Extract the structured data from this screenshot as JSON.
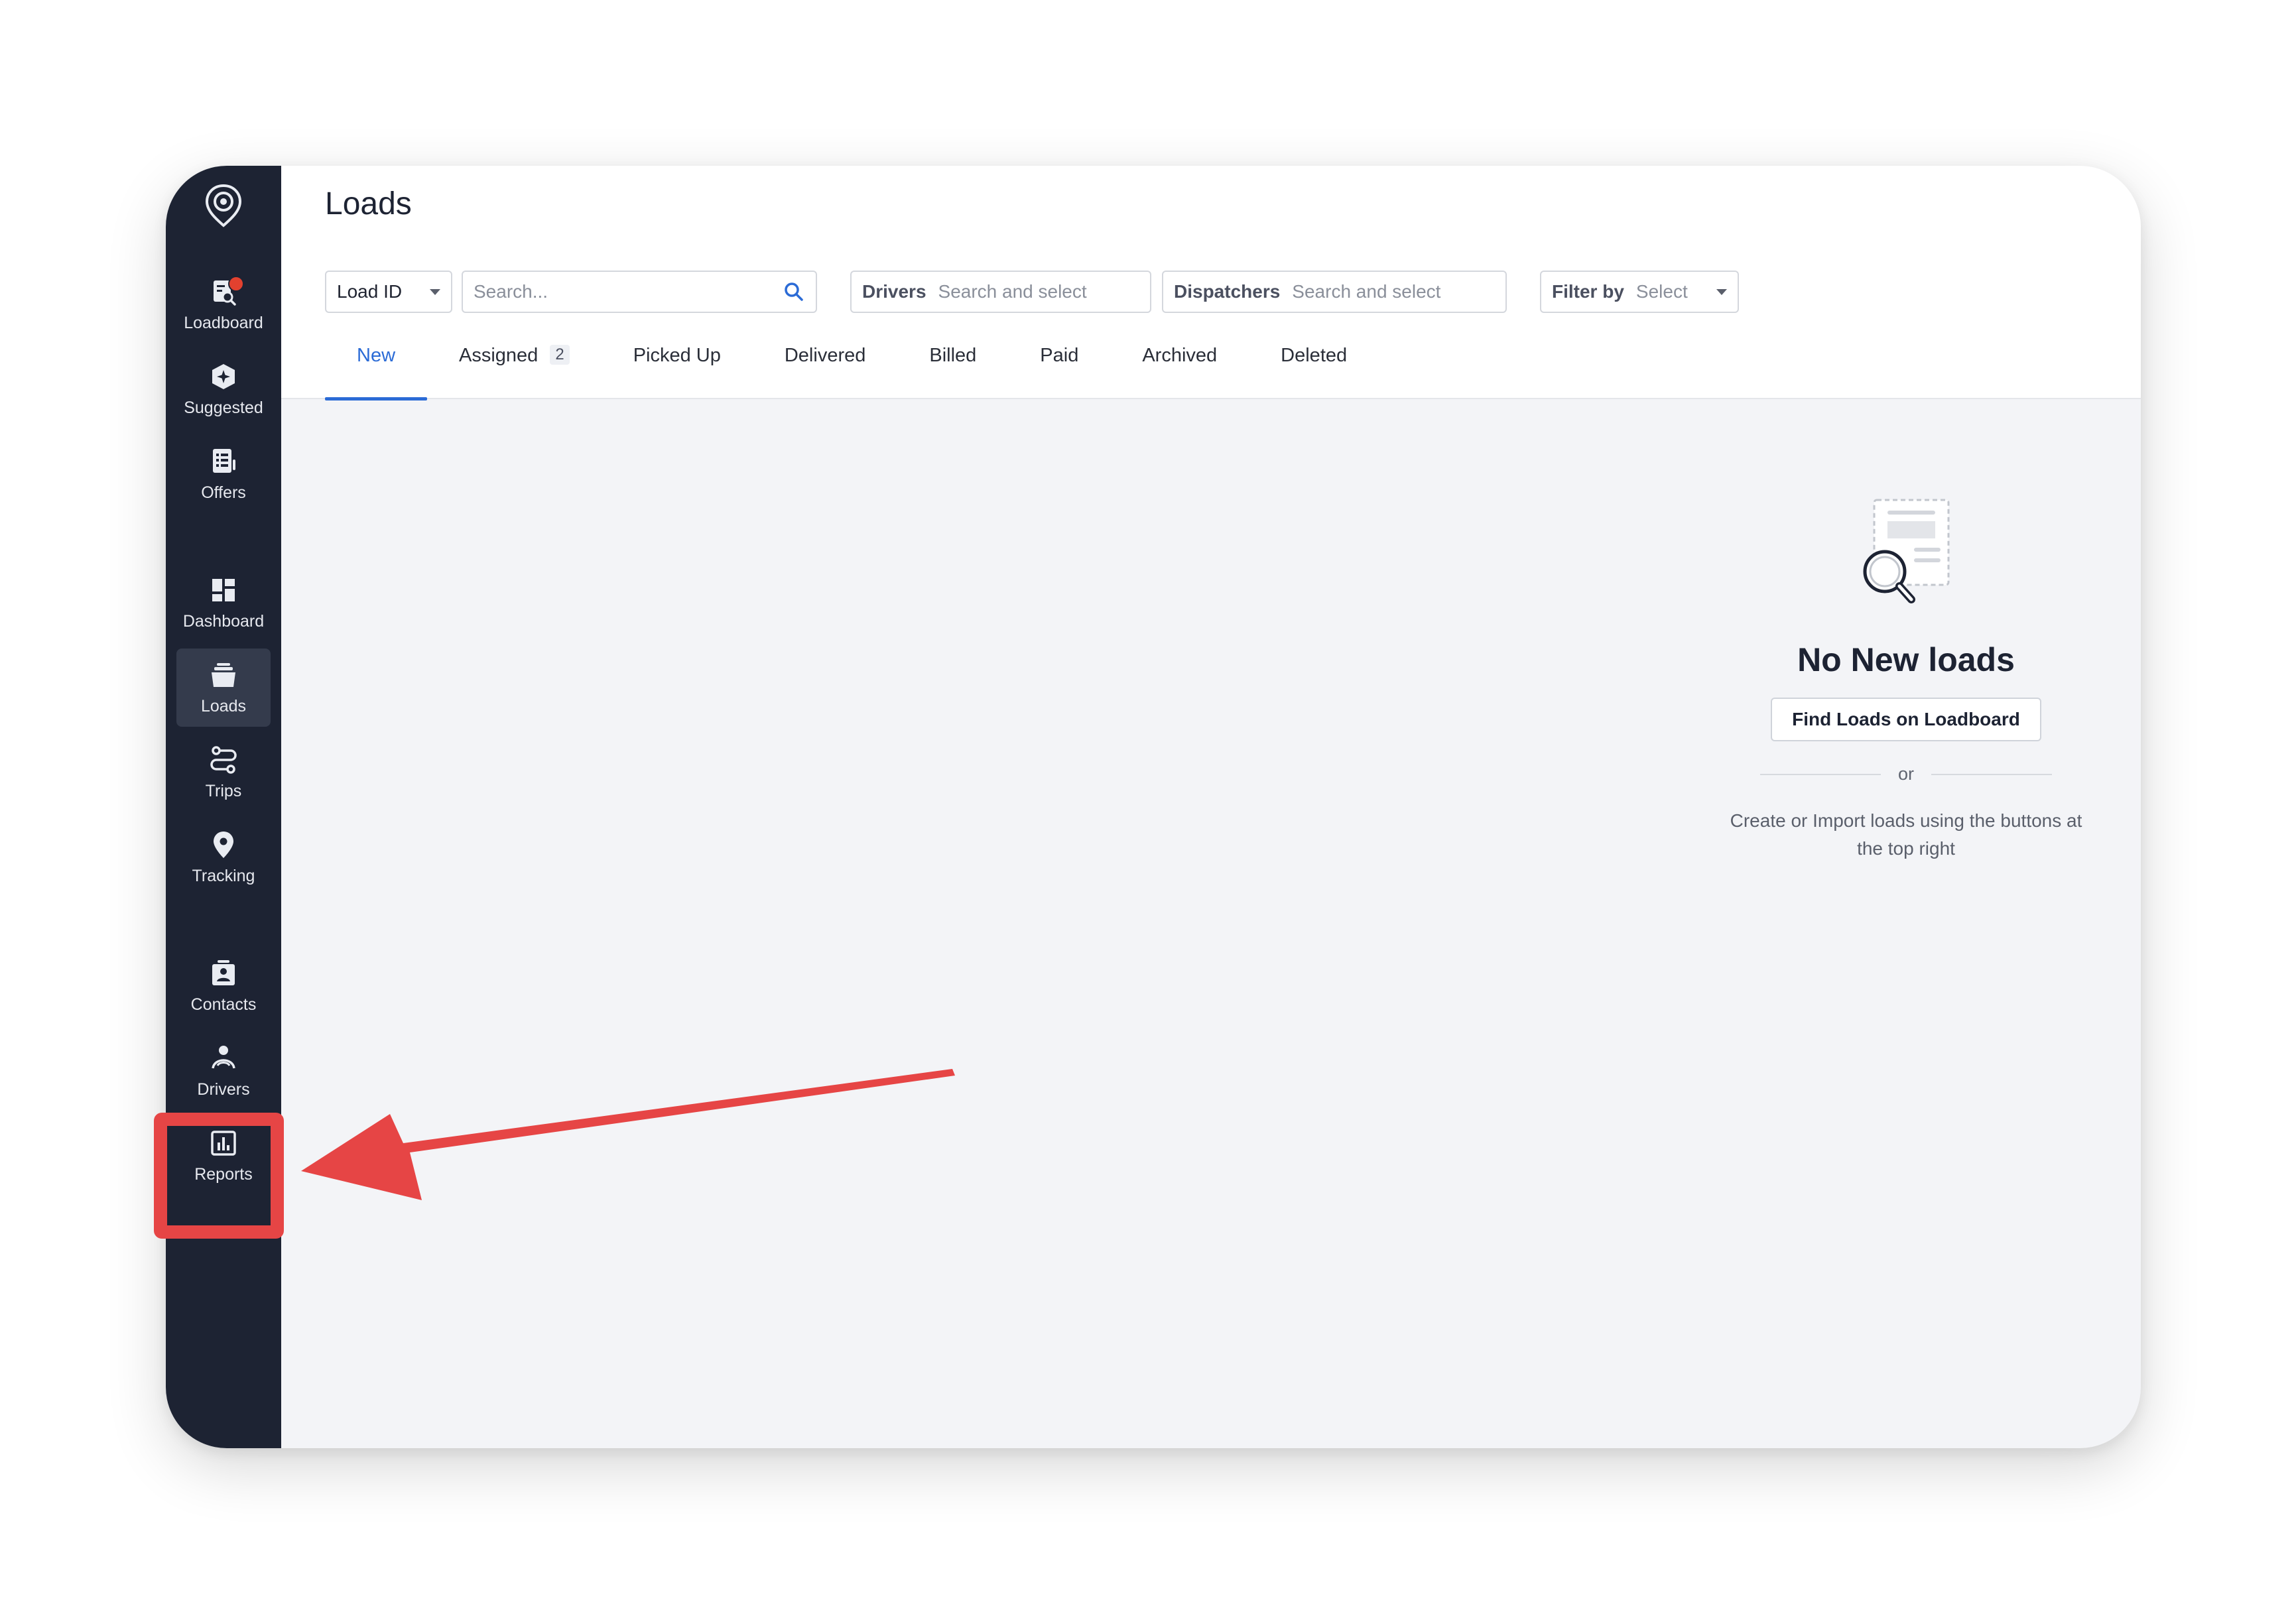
{
  "sidebar": {
    "items": [
      {
        "id": "loadboard",
        "label": "Loadboard",
        "icon": "loadboard-icon"
      },
      {
        "id": "suggested",
        "label": "Suggested",
        "icon": "suggested-icon"
      },
      {
        "id": "offers",
        "label": "Offers",
        "icon": "offers-icon"
      },
      {
        "id": "dashboard",
        "label": "Dashboard",
        "icon": "dashboard-icon"
      },
      {
        "id": "loads",
        "label": "Loads",
        "icon": "loads-icon"
      },
      {
        "id": "trips",
        "label": "Trips",
        "icon": "trips-icon"
      },
      {
        "id": "tracking",
        "label": "Tracking",
        "icon": "location-pin-icon"
      },
      {
        "id": "contacts",
        "label": "Contacts",
        "icon": "contacts-icon"
      },
      {
        "id": "drivers",
        "label": "Drivers",
        "icon": "drivers-icon"
      },
      {
        "id": "reports",
        "label": "Reports",
        "icon": "reports-icon"
      }
    ],
    "active": "loads"
  },
  "header": {
    "title": "Loads"
  },
  "filters": {
    "load_id_select": "Load ID",
    "search_placeholder": "Search...",
    "drivers_label": "Drivers",
    "drivers_placeholder": "Search and select",
    "dispatchers_label": "Dispatchers",
    "dispatchers_placeholder": "Search and select",
    "filter_by_label": "Filter by",
    "filter_by_value": "Select"
  },
  "tabs": [
    {
      "label": "New",
      "active": true
    },
    {
      "label": "Assigned",
      "badge": "2"
    },
    {
      "label": "Picked Up"
    },
    {
      "label": "Delivered"
    },
    {
      "label": "Billed"
    },
    {
      "label": "Paid"
    },
    {
      "label": "Archived"
    },
    {
      "label": "Deleted"
    }
  ],
  "empty_state": {
    "title": "No New loads",
    "button_label": "Find Loads on Loadboard",
    "divider_text": "or",
    "description": "Create or Import loads using the buttons at the top right"
  },
  "colors": {
    "sidebar_bg": "#1d2333",
    "accent": "#2b6bd6",
    "annotation": "#e64545",
    "notification": "#e2412f"
  }
}
